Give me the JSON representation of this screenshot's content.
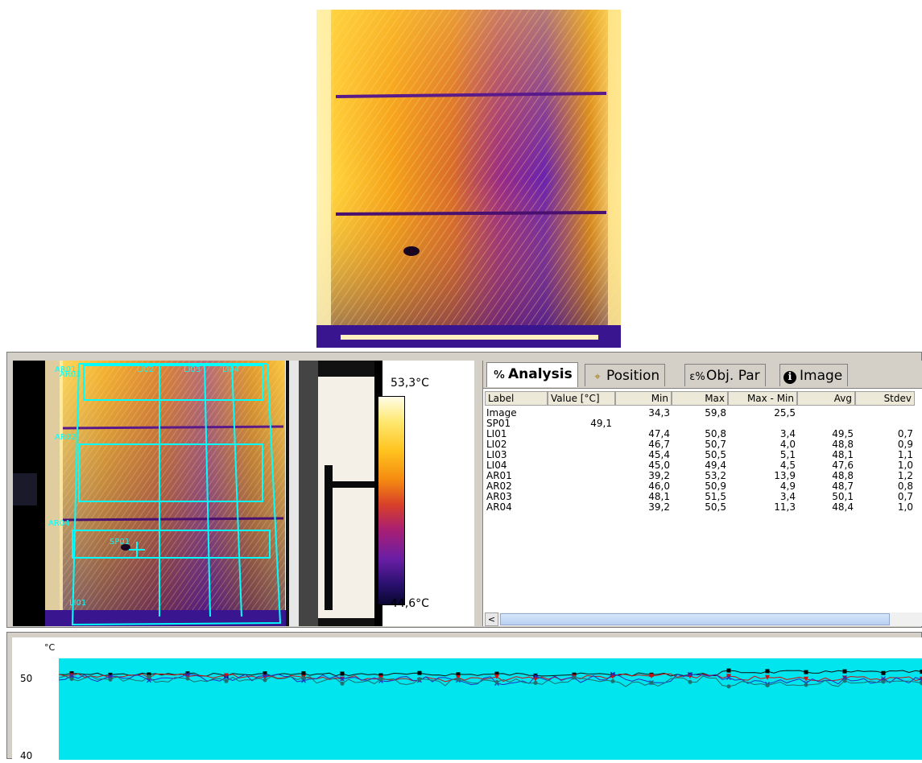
{
  "scale": {
    "max_label": "53,3°C",
    "min_label": "44,6°C"
  },
  "tabs": [
    {
      "label": "Analysis",
      "icon": "analysis-icon",
      "glyph": "⁰⁄₀"
    },
    {
      "label": "Position",
      "icon": "position-icon",
      "glyph": "⌖"
    },
    {
      "label": "Obj. Par",
      "icon": "object-parameters-icon",
      "glyph": "ε%"
    },
    {
      "label": "Image",
      "icon": "info-icon",
      "glyph": "ℹ"
    }
  ],
  "table": {
    "headers": [
      "Label",
      "Value [°C]",
      "Min",
      "Max",
      "Max - Min",
      "Avg",
      "Stdev"
    ],
    "rows": [
      [
        "Image",
        "",
        "34,3",
        "59,8",
        "25,5",
        "",
        ""
      ],
      [
        "SP01",
        "49,1",
        "",
        "",
        "",
        "",
        ""
      ],
      [
        "LI01",
        "",
        "47,4",
        "50,8",
        "3,4",
        "49,5",
        "0,7"
      ],
      [
        "LI02",
        "",
        "46,7",
        "50,7",
        "4,0",
        "48,8",
        "0,9"
      ],
      [
        "LI03",
        "",
        "45,4",
        "50,5",
        "5,1",
        "48,1",
        "1,1"
      ],
      [
        "LI04",
        "",
        "45,0",
        "49,4",
        "4,5",
        "47,6",
        "1,0"
      ],
      [
        "AR01",
        "",
        "39,2",
        "53,2",
        "13,9",
        "48,8",
        "1,2"
      ],
      [
        "AR02",
        "",
        "46,0",
        "50,9",
        "4,9",
        "48,7",
        "0,8"
      ],
      [
        "AR03",
        "",
        "48,1",
        "51,5",
        "3,4",
        "50,1",
        "0,7"
      ],
      [
        "AR04",
        "",
        "39,2",
        "50,5",
        "11,3",
        "48,4",
        "1,0"
      ]
    ]
  },
  "overlay_labels": {
    "ar01": "AR01",
    "ar03": "AR03",
    "ar02": "AR02",
    "ar04": "AR04",
    "li02": "LI02",
    "li03": "LI03",
    "li04": "LI04",
    "li01": "LI01",
    "sp01": "SP01"
  },
  "plot": {
    "unit": "°C",
    "y_ticks": [
      "50",
      "40"
    ]
  },
  "colors": {
    "overlay": "#00ffff",
    "plot_bg": "#00e5ee"
  }
}
